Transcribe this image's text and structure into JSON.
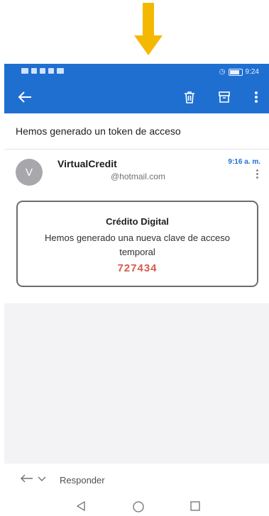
{
  "annotation": {
    "arrow_icon": "down-arrow-icon",
    "arrow_color": "#f5b800"
  },
  "statusbar": {
    "time": "9:24"
  },
  "appbar": {
    "back_icon": "back-arrow-icon",
    "delete_icon": "trash-icon",
    "archive_icon": "archive-icon",
    "more_icon": "more-vertical-icon",
    "color": "#1f6fd1"
  },
  "message": {
    "subject": "Hemos generado un token de acceso",
    "avatar_letter": "V",
    "sender": "VirtualCredit",
    "sender_email": "@hotmail.com",
    "time": "9:16 a. m."
  },
  "card": {
    "title": "Crédito Digital",
    "text": "Hemos generado una nueva clave de acceso temporal",
    "code": "727434",
    "code_color": "#d75b4a"
  },
  "reply": {
    "label": "Responder"
  },
  "navbar": {
    "back_icon": "nav-back-icon",
    "home_icon": "nav-home-icon",
    "recents_icon": "nav-recents-icon"
  }
}
